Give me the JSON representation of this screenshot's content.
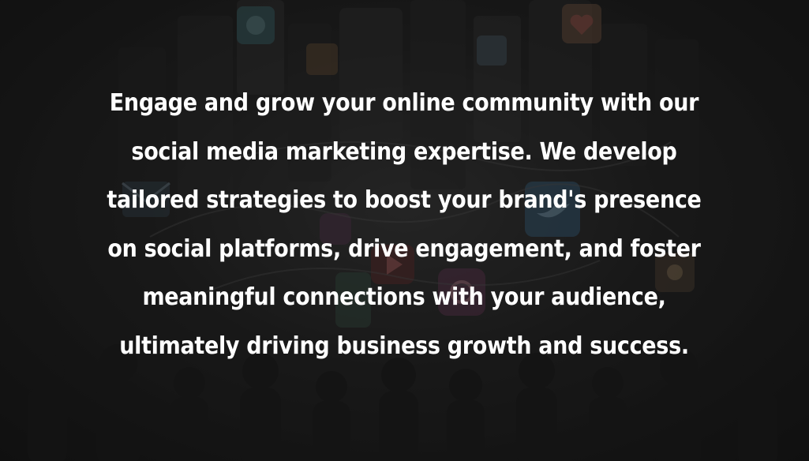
{
  "colors": {
    "background": "#141414",
    "text": "#ffffff"
  },
  "background_image": {
    "icons": [
      "chat-bubble-icon",
      "heart-icon",
      "twitter-bird-icon",
      "instagram-icon",
      "play-icon",
      "mail-icon",
      "like-icon",
      "people-silhouette-icon"
    ]
  },
  "content": {
    "lines": [
      "Engage and grow your online community with our",
      "social media marketing expertise. We develop",
      "tailored strategies to boost your brand's presence",
      "on social platforms, drive engagement, and foster",
      "meaningful connections with your audience,",
      "ultimately driving business growth and success."
    ]
  }
}
